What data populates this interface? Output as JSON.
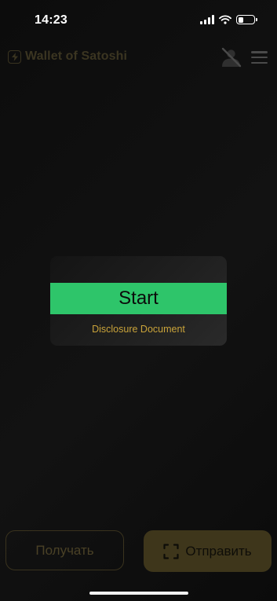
{
  "status_bar": {
    "time": "14:23",
    "signal_icon": "cellular-signal-icon",
    "wifi_icon": "wifi-icon",
    "battery_icon": "battery-icon",
    "battery_level": 0.35
  },
  "header": {
    "app_name": "Wallet of Satoshi",
    "logo_icon": "lightning-bolt-icon",
    "user_icon": "user-offline-icon",
    "menu_icon": "hamburger-menu-icon"
  },
  "card": {
    "start_label": "Start",
    "disclosure_label": "Disclosure Document"
  },
  "actions": {
    "receive_label": "Получать",
    "send_label": "Отправить",
    "scan_icon": "scan-frame-icon"
  },
  "colors": {
    "accent_green": "#2ec56a",
    "link_gold": "#c9a33a",
    "send_button_bg": "#3e361b",
    "background": "#0f0f0f"
  }
}
